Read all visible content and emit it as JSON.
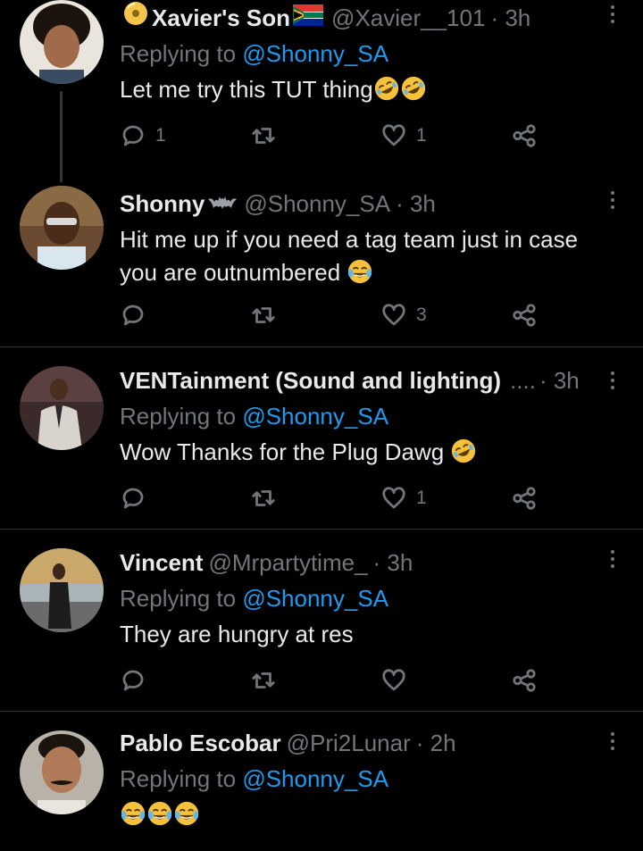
{
  "tweets": [
    {
      "name": "Xavier's Son",
      "handle": "@Xavier__101",
      "time": "· 3h",
      "replying_label": "Replying to",
      "replying_to": "@Shonny_SA",
      "text": "Let me try this TUT thing",
      "text_line2": "",
      "emojis": [
        "rolling-laughing",
        "rolling-laughing"
      ],
      "badge_before": "disc-icon",
      "badge_after": "south-africa-flag-icon",
      "reply_count": "1",
      "retweet_count": "",
      "like_count": "1"
    },
    {
      "name": "Shonny",
      "handle": "@Shonny_SA",
      "time": "· 3h",
      "replying_label": "",
      "replying_to": "",
      "text": "Hit me up if you need a tag team just in case",
      "text_line2": "you are outnumbered",
      "emojis": [
        "tears-of-joy"
      ],
      "badge_after": "bat-icon",
      "reply_count": "",
      "retweet_count": "",
      "like_count": "3"
    },
    {
      "name": "VENTainment (Sound and lighting)",
      "handle": "....",
      "time": "· 3h",
      "replying_label": "Replying to",
      "replying_to": "@Shonny_SA",
      "text": "Wow Thanks for the Plug Dawg",
      "text_line2": "",
      "emojis": [
        "rolling-laughing"
      ],
      "reply_count": "",
      "retweet_count": "",
      "like_count": "1"
    },
    {
      "name": "Vincent",
      "handle": "@Mrpartytime_",
      "time": "· 3h",
      "replying_label": "Replying to",
      "replying_to": "@Shonny_SA",
      "text": "They are hungry at res",
      "text_line2": "",
      "emojis": [],
      "reply_count": "",
      "retweet_count": "",
      "like_count": ""
    },
    {
      "name": "Pablo Escobar",
      "handle": "@Pri2Lunar",
      "time": "· 2h",
      "replying_label": "Replying to",
      "replying_to": "@Shonny_SA",
      "text": "",
      "text_line2": "",
      "emojis": [
        "tears-of-joy",
        "tears-of-joy",
        "tears-of-joy"
      ],
      "reply_count": "",
      "retweet_count": "",
      "like_count": ""
    }
  ],
  "colors": {
    "background": "#000000",
    "text": "#e7e9ea",
    "muted": "#71767b",
    "link": "#1d9bf0",
    "divider": "#2f3336"
  }
}
